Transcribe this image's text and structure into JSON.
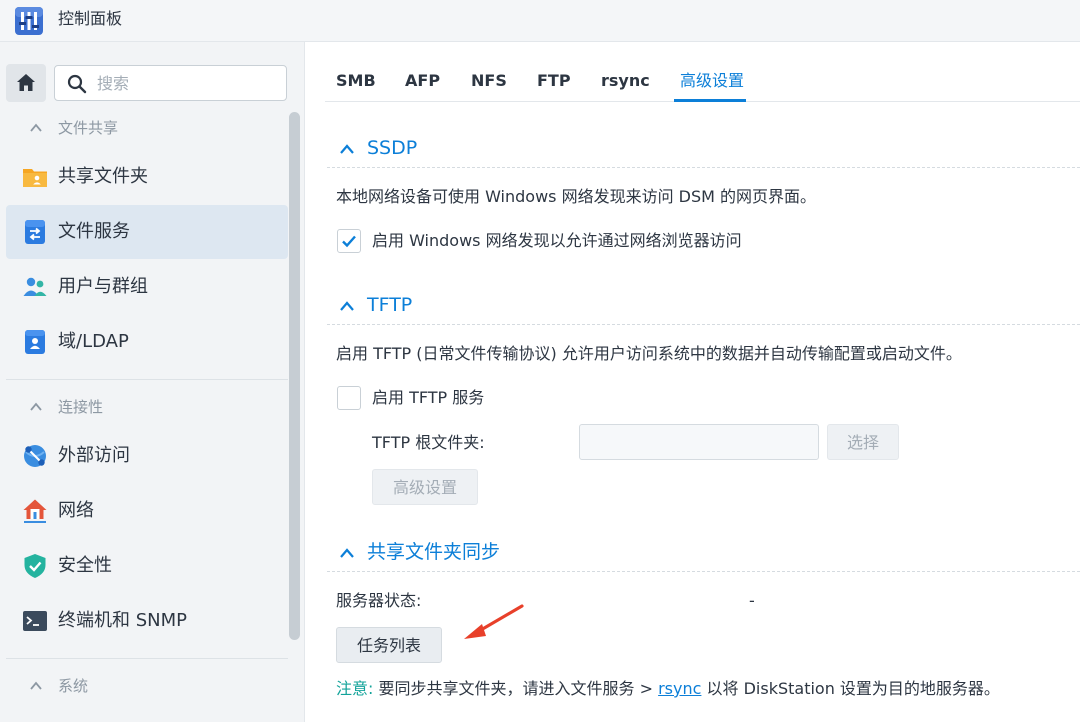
{
  "window": {
    "title": "控制面板"
  },
  "search": {
    "placeholder": "搜索"
  },
  "sidebar": {
    "groups": [
      {
        "label": "文件共享"
      },
      {
        "label": "连接性"
      },
      {
        "label": "系统"
      }
    ],
    "items": [
      {
        "label": "共享文件夹",
        "icon": "folder-user-icon"
      },
      {
        "label": "文件服务",
        "icon": "file-services-icon"
      },
      {
        "label": "用户与群组",
        "icon": "users-icon"
      },
      {
        "label": "域/LDAP",
        "icon": "domain-icon"
      },
      {
        "label": "外部访问",
        "icon": "external-access-icon"
      },
      {
        "label": "网络",
        "icon": "network-icon"
      },
      {
        "label": "安全性",
        "icon": "shield-icon"
      },
      {
        "label": "终端机和 SNMP",
        "icon": "terminal-icon"
      }
    ],
    "active_item": "文件服务"
  },
  "tabs": [
    {
      "label": "SMB"
    },
    {
      "label": "AFP"
    },
    {
      "label": "NFS"
    },
    {
      "label": "FTP"
    },
    {
      "label": "rsync"
    },
    {
      "label": "高级设置"
    }
  ],
  "active_tab": "高级设置",
  "ssdp": {
    "title": "SSDP",
    "description": "本地网络设备可使用 Windows 网络发现来访问 DSM 的网页界面。",
    "checkbox_label": "启用 Windows 网络发现以允许通过网络浏览器访问",
    "checked": true
  },
  "tftp": {
    "title": "TFTP",
    "description": "启用 TFTP (日常文件传输协议) 允许用户访问系统中的数据并自动传输配置或启动文件。",
    "checkbox_label": "启用 TFTP 服务",
    "checked": false,
    "root_folder_label": "TFTP 根文件夹:",
    "root_folder_value": "",
    "select_button": "选择",
    "advanced_button": "高级设置"
  },
  "sync": {
    "title": "共享文件夹同步",
    "status_label": "服务器状态:",
    "status_value": "-",
    "task_list_button": "任务列表",
    "note_label": "注意:",
    "note_text_before": "要同步共享文件夹，请进入文件服务 > ",
    "note_link": "rsync",
    "note_text_after": " 以将 DiskStation 设置为目的地服务器。"
  },
  "colors": {
    "accent": "#0c7fd8",
    "note": "#12a39a",
    "arrow": "#e8402a"
  }
}
